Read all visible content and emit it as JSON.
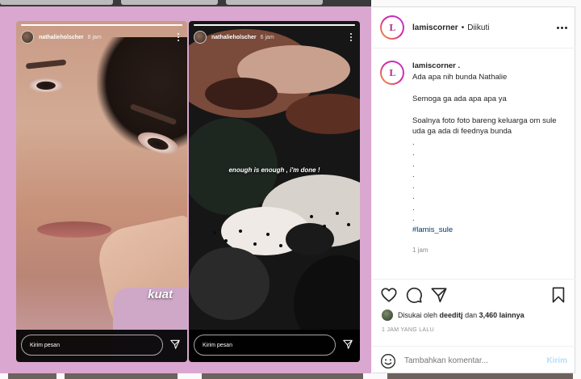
{
  "stories": [
    {
      "username": "nathalieholscher",
      "time": "8 jam",
      "sticker_text": "kuat",
      "reply_placeholder": "Kirim pesan",
      "progress": 1.0
    },
    {
      "username": "nathalieholscher",
      "time": "6 jam",
      "overlay_text": "enough is enough , i'm done !",
      "reply_placeholder": "Kirim pesan",
      "progress": 1.0
    }
  ],
  "post": {
    "header": {
      "username": "lamiscorner",
      "separator": "•",
      "follow_status": "Diikuti"
    },
    "caption": {
      "username": "lamiscorner .",
      "lines": [
        "Ada apa nih bunda Nathalie",
        "",
        "Semoga ga ada apa apa ya",
        "",
        "Soalnya foto foto bareng keluarga om sule uda ga ada di feednya bunda",
        ".",
        ".",
        ".",
        ".",
        ".",
        ".",
        ".",
        "."
      ],
      "hashtag": "#lamis_sule",
      "time": "1 jam"
    },
    "likes": {
      "prefix": "Disukai oleh",
      "user": "deeditj",
      "middle": "dan",
      "count": "3,460 lainnya"
    },
    "date": "1 JAM YANG LALU",
    "comment": {
      "placeholder": "Tambahkan komentar...",
      "post_label": "Kirim"
    }
  },
  "colors": {
    "frame": "#d9a7cf",
    "link": "#00376b",
    "muted": "#8e8e8e",
    "post_button": "#b2dffc"
  },
  "icons": [
    "heart-icon",
    "comment-icon",
    "share-icon",
    "bookmark-icon",
    "emoji-icon",
    "send-icon",
    "more-icon"
  ]
}
